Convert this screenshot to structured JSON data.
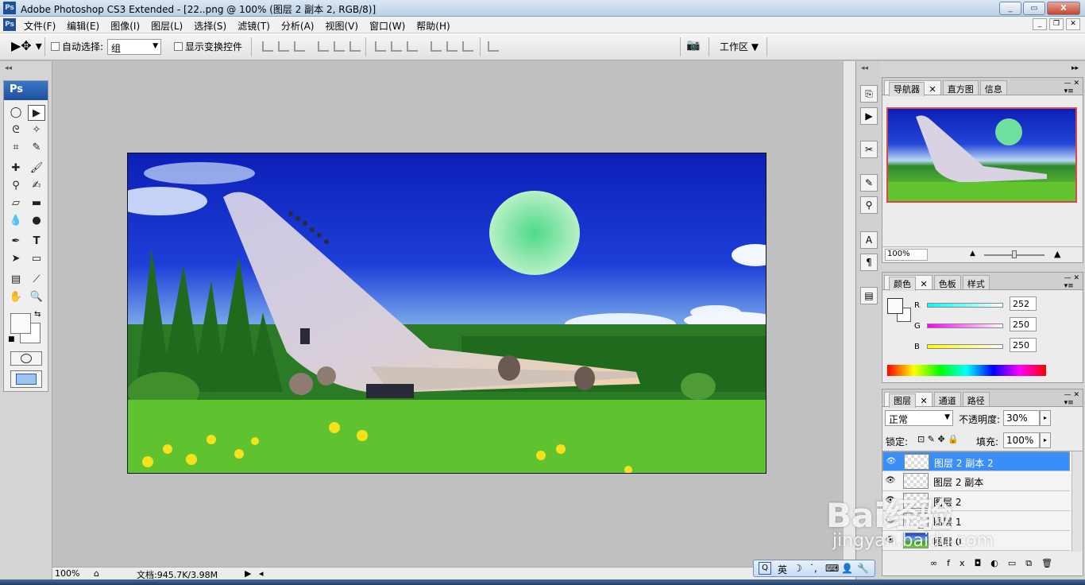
{
  "window": {
    "title": "Adobe Photoshop CS3 Extended - [22..png @ 100% (图层 2 副本 2, RGB/8)]",
    "buttons": [
      "_",
      "▭",
      "X"
    ]
  },
  "menubar": {
    "items": [
      "文件(F)",
      "编辑(E)",
      "图像(I)",
      "图层(L)",
      "选择(S)",
      "滤镜(T)",
      "分析(A)",
      "视图(V)",
      "窗口(W)",
      "帮助(H)"
    ]
  },
  "options": {
    "auto_select_label": "自动选择:",
    "auto_select_value": "组",
    "show_transform_label": "显示变换控件",
    "workspace_label": "工作区"
  },
  "toolbox": {
    "header": "Ps"
  },
  "status": {
    "zoom": "100%",
    "doc": "文档:945.7K/3.98M"
  },
  "navigator": {
    "tabs": [
      "导航器",
      "直方图",
      "信息"
    ],
    "zoom": "100%"
  },
  "color_panel": {
    "tabs": [
      "颜色",
      "色板",
      "样式"
    ],
    "r_label": "R",
    "g_label": "G",
    "b_label": "B",
    "r": "252",
    "g": "250",
    "b": "250"
  },
  "layers_panel": {
    "tabs": [
      "图层",
      "通道",
      "路径"
    ],
    "blend_mode": "正常",
    "opacity_label": "不透明度:",
    "opacity": "30%",
    "lock_label": "锁定:",
    "fill_label": "填充:",
    "fill": "100%",
    "layers": [
      "图层 2 副本 2",
      "图层 2 副本",
      "图层 2",
      "图层 1",
      "图层 0"
    ]
  },
  "ime": {
    "lang": "英"
  },
  "watermark": {
    "brand": "Bai经验",
    "url": "jingyan.baidu.com"
  },
  "colors": {
    "selection": "#3a8ef7",
    "ps_blue": "#1f4f9a"
  }
}
